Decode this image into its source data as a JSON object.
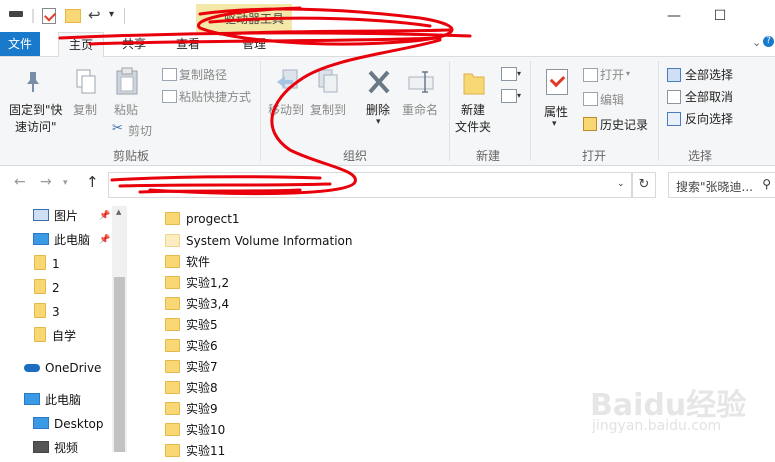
{
  "window": {
    "tool_tab_label": "驱动器工具",
    "minimize_label": "—",
    "maximize_label": "☐"
  },
  "tabs": {
    "file": "文件",
    "home": "主页",
    "share": "共享",
    "view": "查看",
    "manage": "管理"
  },
  "ribbon": {
    "clipboard": {
      "label": "剪贴板",
      "pin_quick_access": [
        "固定到\"快",
        "速访问\""
      ],
      "copy": "复制",
      "paste": "粘贴",
      "copy_path": "复制路径",
      "paste_shortcut": "粘贴快捷方式",
      "cut": "剪切"
    },
    "organize": {
      "label": "组织",
      "move_to": "移动到",
      "copy_to": "复制到",
      "delete": "删除",
      "rename": "重命名"
    },
    "new": {
      "label": "新建",
      "new_folder": [
        "新建",
        "文件夹"
      ]
    },
    "open": {
      "label": "打开",
      "properties": "属性",
      "open": "打开",
      "edit": "编辑",
      "history": "历史记录"
    },
    "select": {
      "label": "选择",
      "select_all": "全部选择",
      "select_none": "全部取消",
      "invert_selection": "反向选择"
    }
  },
  "search": {
    "placeholder": "搜索\"张晓迪..."
  },
  "nav_pane": {
    "items": [
      {
        "label": "图片",
        "icon": "pictures-icon"
      },
      {
        "label": "此电脑",
        "icon": "computer-icon"
      },
      {
        "label": "1",
        "icon": "folder-icon"
      },
      {
        "label": "2",
        "icon": "folder-icon"
      },
      {
        "label": "3",
        "icon": "folder-icon"
      },
      {
        "label": "自学",
        "icon": "folder-icon"
      },
      {
        "label": "OneDrive",
        "icon": "cloud-icon"
      },
      {
        "label": "此电脑",
        "icon": "computer-icon"
      },
      {
        "label": "Desktop",
        "icon": "desktop-icon"
      },
      {
        "label": "视频",
        "icon": "video-icon"
      }
    ]
  },
  "files": [
    {
      "name": "progect1",
      "type": "folder"
    },
    {
      "name": "System Volume Information",
      "type": "system-folder"
    },
    {
      "name": "软件",
      "type": "folder"
    },
    {
      "name": "实验1,2",
      "type": "folder"
    },
    {
      "name": "实验3,4",
      "type": "folder"
    },
    {
      "name": "实验5",
      "type": "folder"
    },
    {
      "name": "实验6",
      "type": "folder"
    },
    {
      "name": "实验7",
      "type": "folder"
    },
    {
      "name": "实验8",
      "type": "folder"
    },
    {
      "name": "实验9",
      "type": "folder"
    },
    {
      "name": "实验10",
      "type": "folder"
    },
    {
      "name": "实验11",
      "type": "folder"
    }
  ],
  "watermark": {
    "brand": "Baidu经验",
    "url": "jingyan.baidu.com"
  },
  "colors": {
    "file_tab": "#1979ca",
    "tool_tab": "#f3e8a8",
    "ribbon_bg": "#f5f6f7",
    "folder": "#f8d775",
    "scribble": "#e8000b"
  }
}
